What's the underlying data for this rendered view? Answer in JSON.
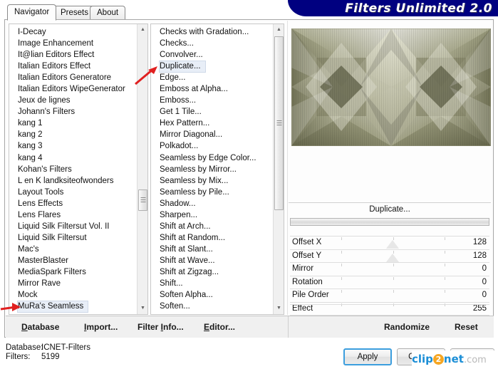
{
  "window": {
    "banner_title": "Filters Unlimited 2.0"
  },
  "tabs": [
    {
      "label": "Navigator",
      "active": true
    },
    {
      "label": "Presets",
      "active": false
    },
    {
      "label": "About",
      "active": false
    }
  ],
  "categories_list": {
    "name": "filter-category-list",
    "selected": "MuRa's Seamless",
    "items": [
      "I-Decay",
      "Image Enhancement",
      "It@lian Editors Effect",
      "Italian Editors Effect",
      "Italian Editors Generatore",
      "Italian Editors WipeGenerator",
      "Jeux de lignes",
      "Johann's Filters",
      "kang 1",
      "kang 2",
      "kang 3",
      "kang 4",
      "Kohan's Filters",
      "L en K landksiteofwonders",
      "Layout Tools",
      "Lens Effects",
      "Lens Flares",
      "Liquid Silk Filtersut Vol. II",
      "Liquid Silk Filtersut",
      "Mac's",
      "MasterBlaster",
      "MediaSpark Filters",
      "Mirror Rave",
      "Mock",
      "MuRa's Seamless"
    ]
  },
  "filters_list": {
    "name": "filter-effect-list",
    "selected": "Duplicate...",
    "items": [
      "Checks with Gradation...",
      "Checks...",
      "Convolver...",
      "Duplicate...",
      "Edge...",
      "Emboss at Alpha...",
      "Emboss...",
      "Get 1 Tile...",
      "Hex Pattern...",
      "Mirror Diagonal...",
      "Polkadot...",
      "Seamless by Edge Color...",
      "Seamless by Mirror...",
      "Seamless by Mix...",
      "Seamless by Pile...",
      "Shadow...",
      "Sharpen...",
      "Shift at Arch...",
      "Shift at Random...",
      "Shift at Slant...",
      "Shift at Wave...",
      "Shift at Zigzag...",
      "Shift...",
      "Soften Alpha...",
      "Soften..."
    ]
  },
  "preview": {
    "alt": "geometric symmetric khaki pattern preview"
  },
  "parameters": {
    "title": "Duplicate...",
    "rows": [
      {
        "name": "Offset X",
        "value": "128",
        "has_slider": true
      },
      {
        "name": "Offset Y",
        "value": "128",
        "has_slider": true
      },
      {
        "name": "Mirror",
        "value": "0",
        "has_slider": false
      },
      {
        "name": "Rotation",
        "value": "0",
        "has_slider": false
      },
      {
        "name": "Pile Order",
        "value": "0",
        "has_slider": false
      },
      {
        "name": "Effect",
        "value": "255",
        "has_slider": false
      }
    ]
  },
  "command_bar": {
    "database": {
      "label": "Database",
      "accel": "D"
    },
    "import": {
      "label": "Import...",
      "accel": "I"
    },
    "filter_info": {
      "label": "Filter Info...",
      "accel": "I"
    },
    "editor": {
      "label": "Editor...",
      "accel": "E"
    },
    "randomize": {
      "label": "Randomize"
    },
    "reset": {
      "label": "Reset"
    }
  },
  "status": {
    "database_label": "Database:",
    "database_value": "ICNET-Filters",
    "filters_label": "Filters:",
    "filters_value": "5199"
  },
  "buttons": {
    "apply": "Apply",
    "cancel": "Cancel",
    "help": "Help"
  },
  "watermark": {
    "clip": "clip",
    "two": "2",
    "net": "net",
    "com": ".com"
  },
  "colors": {
    "banner_blue": "#000080",
    "selection": "#e8eef7",
    "arrow_red": "#e02020",
    "primary_button_border": "#3c9ede"
  }
}
